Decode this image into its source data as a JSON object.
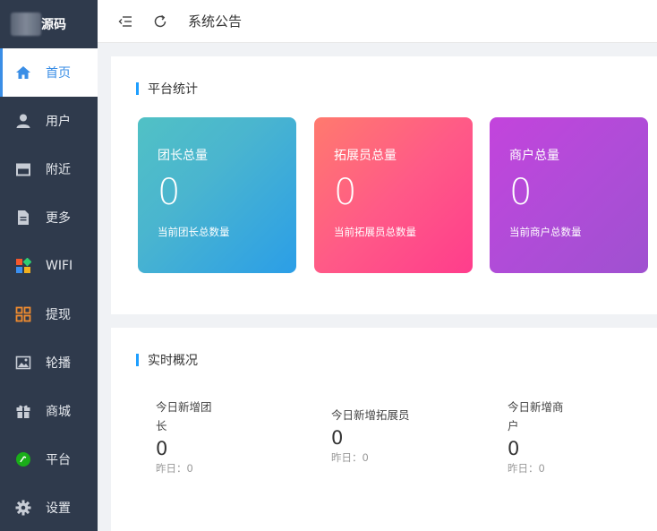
{
  "brand": {
    "text": "源码"
  },
  "sidebar": {
    "items": [
      {
        "label": "首页",
        "icon": "home-icon"
      },
      {
        "label": "用户",
        "icon": "user-icon"
      },
      {
        "label": "附近",
        "icon": "store-icon"
      },
      {
        "label": "更多",
        "icon": "document-icon"
      },
      {
        "label": "WIFI",
        "icon": "app-grid-icon"
      },
      {
        "label": "提现",
        "icon": "grid-icon"
      },
      {
        "label": "轮播",
        "icon": "image-icon"
      },
      {
        "label": "商城",
        "icon": "gift-icon"
      },
      {
        "label": "平台",
        "icon": "circle-icon"
      },
      {
        "label": "设置",
        "icon": "gear-icon"
      }
    ],
    "active_index": 0
  },
  "header": {
    "title": "系统公告"
  },
  "stats": {
    "title": "平台统计",
    "cards": [
      {
        "label": "团长总量",
        "value": "0",
        "sub": "当前团长总数量"
      },
      {
        "label": "拓展员总量",
        "value": "0",
        "sub": "当前拓展员总数量"
      },
      {
        "label": "商户总量",
        "value": "0",
        "sub": "当前商户总数量"
      }
    ]
  },
  "realtime": {
    "title": "实时概况",
    "items": [
      {
        "label_line1": "今日新增团",
        "label_line2": "长",
        "value": "0",
        "yesterday": "昨日：0"
      },
      {
        "label_line1": "今日新增拓展员",
        "label_line2": "",
        "value": "0",
        "yesterday": "昨日：0"
      },
      {
        "label_line1": "今日新增商",
        "label_line2": "户",
        "value": "0",
        "yesterday": "昨日：0"
      }
    ]
  },
  "colors": {
    "sidebar_bg": "#2f3a4c",
    "active_accent": "#3a8ee6",
    "section_bar": "#1e9fff"
  }
}
